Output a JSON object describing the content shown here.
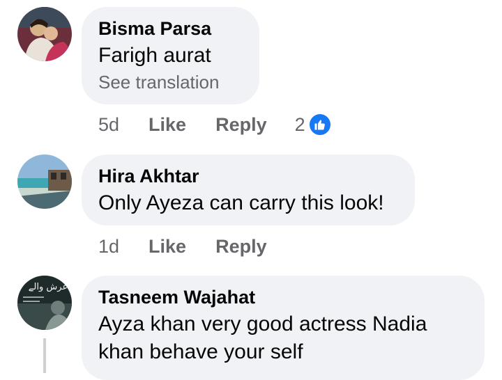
{
  "comments": [
    {
      "author": "Bisma Parsa",
      "text": "Farigh aurat",
      "translation": "See translation",
      "time": "5d",
      "like": "Like",
      "reply": "Reply",
      "reaction_count": "2",
      "reaction_icon": "like-icon",
      "accent": "#1877f2"
    },
    {
      "author": "Hira Akhtar",
      "text": "Only Ayeza can carry this look!",
      "time": "1d",
      "like": "Like",
      "reply": "Reply"
    },
    {
      "author": "Tasneem Wajahat",
      "text_lines": [
        "Ayza khan very good actress Nadia",
        "khan behave your self"
      ],
      "avatar_text": "عرش والے"
    }
  ]
}
